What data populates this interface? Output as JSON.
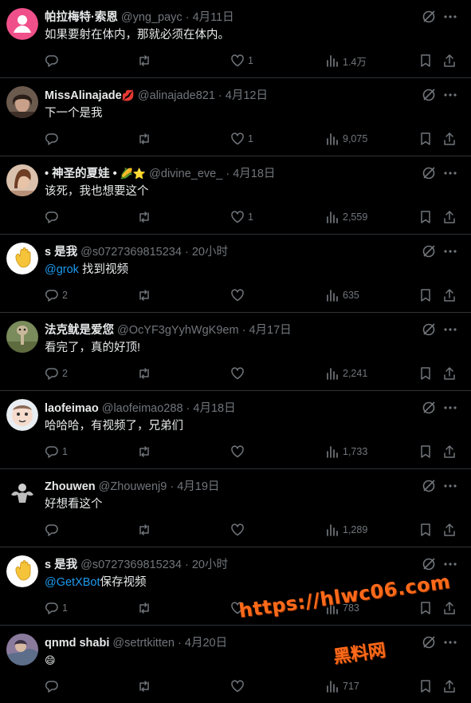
{
  "colors": {
    "background": "#000000",
    "text": "#e7e9ea",
    "muted": "#71767b",
    "link": "#1d9bf0",
    "divider": "#2f3336",
    "watermark": "#ff6a1a"
  },
  "tweets": [
    {
      "name": "帕拉梅特·索恩",
      "name_emoji": "",
      "handle": "@yng_payc",
      "time": "4月11日",
      "mention": "",
      "text": "如果要射在体内，那就必须在体内。",
      "replies": "",
      "retweets": "",
      "likes": "1",
      "views": "1.4万",
      "avatar": "pink-default-avatar"
    },
    {
      "name": "MissAlinajade",
      "name_emoji": "💋",
      "handle": "@alinajade821",
      "time": "4月12日",
      "mention": "",
      "text": "下一个是我",
      "replies": "",
      "retweets": "",
      "likes": "1",
      "views": "9,075",
      "avatar": "photo-avatar"
    },
    {
      "name": "• 神圣的夏娃 •",
      "name_emoji": "🌽⭐",
      "handle": "@divine_eve_",
      "time": "4月18日",
      "mention": "",
      "text": "该死，我也想要这个",
      "replies": "",
      "retweets": "",
      "likes": "1",
      "views": "2,559",
      "avatar": "photo-avatar"
    },
    {
      "name": "s 是我",
      "name_emoji": "",
      "handle": "@s0727369815234",
      "time": "20小时",
      "mention": "@grok",
      "text": " 找到视频",
      "replies": "2",
      "retweets": "",
      "likes": "",
      "views": "635",
      "avatar": "wave-hand-avatar"
    },
    {
      "name": "法克鱿是爱您",
      "name_emoji": "",
      "handle": "@OcYF3gYyhWgK9em",
      "time": "4月17日",
      "mention": "",
      "text": "看完了，真的好顶!",
      "replies": "2",
      "retweets": "",
      "likes": "",
      "views": "2,241",
      "avatar": "ostrich-avatar"
    },
    {
      "name": "laofeimao",
      "name_emoji": "",
      "handle": "@laofeimao288",
      "time": "4月18日",
      "mention": "",
      "text": "哈哈哈，有视频了，兄弟们",
      "replies": "1",
      "retweets": "",
      "likes": "",
      "views": "1,733",
      "avatar": "cartoon-avatar"
    },
    {
      "name": "Zhouwen",
      "name_emoji": "",
      "handle": "@Zhouwenj9",
      "time": "4月19日",
      "mention": "",
      "text": "好想看这个",
      "replies": "",
      "retweets": "",
      "likes": "",
      "views": "1,289",
      "avatar": "muscle-avatar"
    },
    {
      "name": "s 是我",
      "name_emoji": "",
      "handle": "@s0727369815234",
      "time": "20小时",
      "mention": "@GetXBot",
      "text": "保存视频",
      "replies": "1",
      "retweets": "",
      "likes": "",
      "views": "783",
      "avatar": "wave-hand-avatar"
    },
    {
      "name": "qnmd shabi",
      "name_emoji": "",
      "handle": "@setrtkitten",
      "time": "4月20日",
      "mention": "",
      "text": "😄",
      "replies": "",
      "retweets": "",
      "likes": "",
      "views": "717",
      "avatar": "painting-avatar"
    }
  ],
  "watermark": {
    "url": "https://hlwc06.com",
    "name": "黑料网"
  }
}
